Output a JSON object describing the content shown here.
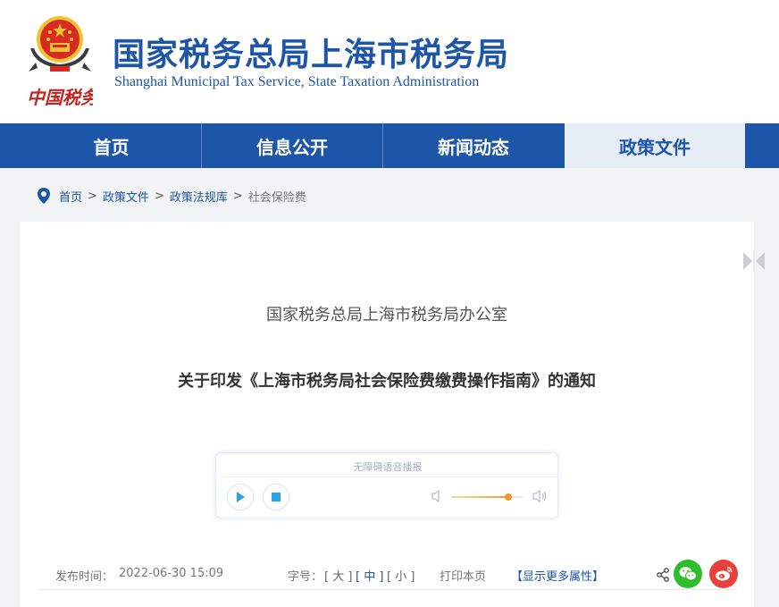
{
  "header": {
    "logo_text": "中国税务",
    "title": "国家税务总局上海市税务局",
    "subtitle": "Shanghai Municipal Tax Service, State Taxation Administration"
  },
  "nav": {
    "items": [
      {
        "label": "首页",
        "active": false
      },
      {
        "label": "信息公开",
        "active": false
      },
      {
        "label": "新闻动态",
        "active": false
      },
      {
        "label": "政策文件",
        "active": true
      }
    ]
  },
  "breadcrumb": {
    "items": [
      "首页",
      "政策文件",
      "政策法规库"
    ],
    "separator": ">",
    "current": "社会保险费"
  },
  "article": {
    "issuer": "国家税务总局上海市税务局办公室",
    "title": "关于印发《上海市税务局社会保险费缴费操作指南》的通知"
  },
  "player": {
    "label": "无障碍语音播报",
    "volume": 0.8
  },
  "meta": {
    "publish_label": "发布时间：",
    "publish_time": "2022-06-30 15:09",
    "font_size_label": "字号：",
    "font_large": "[ 大 ]",
    "font_medium": "[ 中 ]",
    "font_small": "[ 小 ]",
    "print_label": "打印本页",
    "more_label": "【显示更多属性】"
  },
  "colors": {
    "brand_blue": "#1d55a8",
    "nav_active_bg": "#e8eef7",
    "wechat_green": "#2dbd2d",
    "weibo_red": "#e8403a",
    "volume_orange": "#f29a2e"
  }
}
